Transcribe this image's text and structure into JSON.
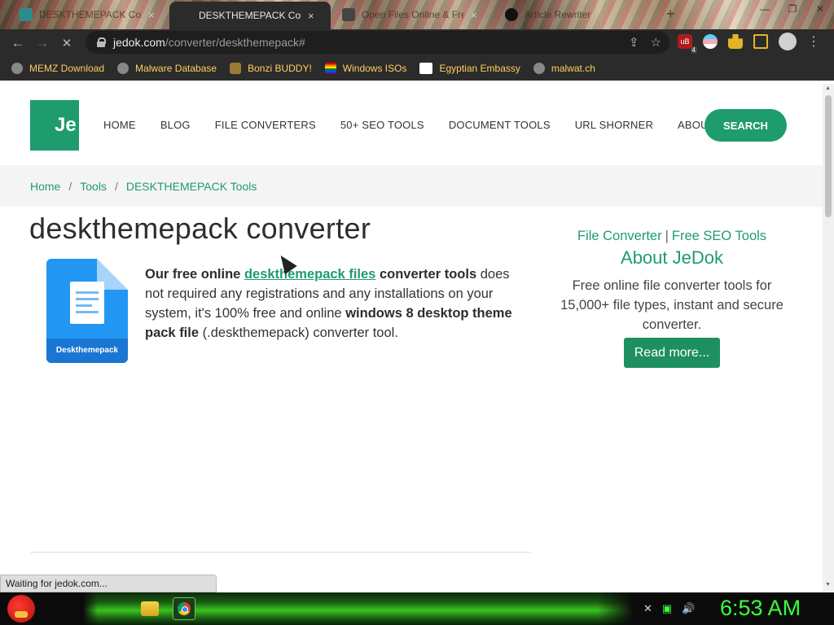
{
  "browser": {
    "tabs": [
      {
        "title": "DESKTHEMEPACK Conve",
        "state": "inactive",
        "favicon_color": "#2e8b8b"
      },
      {
        "title": "DESKTHEMEPACK Conver",
        "state": "active",
        "favicon_color": "#2b2b2b"
      },
      {
        "title": "Open Files Online & Fre",
        "state": "inactive",
        "favicon_color": "#444444"
      },
      {
        "title": "Article Rewriter",
        "state": "inactive",
        "favicon_color": "#111111"
      }
    ],
    "close_glyph": "×",
    "new_tab_glyph": "+",
    "window_controls": [
      "—",
      "❐",
      "✕"
    ],
    "nav": {
      "back": "←",
      "forward": "→",
      "reload": "✕"
    },
    "address": {
      "host": "jedok.com",
      "path": "/converter/deskthemepack#"
    },
    "omnibox_icons": [
      "share-icon",
      "star-icon"
    ],
    "extensions": [
      {
        "name": "ublock-icon",
        "color": "#b01c1c",
        "badge": "4"
      },
      {
        "name": "flag-icon",
        "color": "#e89bb0",
        "badge": ""
      },
      {
        "name": "puzzle-icon",
        "color": "#e5b529",
        "badge": ""
      },
      {
        "name": "sidepanel-icon",
        "color": "#e5b529",
        "badge": ""
      },
      {
        "name": "profile-icon",
        "color": "#d0d0d0",
        "badge": ""
      }
    ],
    "menu_glyph": "⋮",
    "bookmarks": [
      {
        "label": "MEMZ Download",
        "icon": "globe-icon",
        "color": "#888888"
      },
      {
        "label": "Malware Database",
        "icon": "globe-icon",
        "color": "#888888"
      },
      {
        "label": "Bonzi BUDDY!",
        "icon": "bonzi-icon",
        "color": "#9b7a3a"
      },
      {
        "label": "Windows ISOs",
        "icon": "rainbow-icon",
        "color": "#e04040"
      },
      {
        "label": "Egyptian Embassy",
        "icon": "wix-icon",
        "color": "#ffffff"
      },
      {
        "label": "malwat.ch",
        "icon": "globe-icon",
        "color": "#888888"
      }
    ],
    "status_text": "Waiting for jedok.com..."
  },
  "site": {
    "logo_text": "Je",
    "nav": [
      "HOME",
      "BLOG",
      "FILE CONVERTERS",
      "50+ SEO TOOLS",
      "DOCUMENT TOOLS",
      "URL SHORNER",
      "ABOUT"
    ],
    "search_label": "SEARCH",
    "breadcrumb": {
      "home": "Home",
      "tools": "Tools",
      "current": "DESKTHEMEPACK Tools",
      "separator": "/"
    },
    "title": "deskthemepack converter",
    "file_icon_label": "Deskthemepack",
    "intro": {
      "p1_bold": "Our free online ",
      "p1_link": "deskthemepack files",
      "p1_bold2": " converter tools",
      "p1_rest": " does not required any registrations and any installations on your system, it's 100% free and online ",
      "p1_bold3": "windows 8 desktop theme pack file",
      "p1_end": " (.deskthemepack) converter tool."
    },
    "sidebar": {
      "link1": "File Converter",
      "pipe": "|",
      "link2": "Free SEO Tools",
      "heading": "About JeDok",
      "text": "Free online file converter tools for 15,000+ file types, instant and secure converter.",
      "button": "Read more..."
    }
  },
  "taskbar": {
    "pinned": [
      "folder-icon",
      "chrome-icon"
    ],
    "tray": [
      "network-icon",
      "monitor-icon",
      "volume-icon"
    ],
    "tray_glyphs": [
      "✕",
      "▣",
      "🔊"
    ],
    "clock": "6:53 AM",
    "accent_color": "#3cff3c"
  }
}
